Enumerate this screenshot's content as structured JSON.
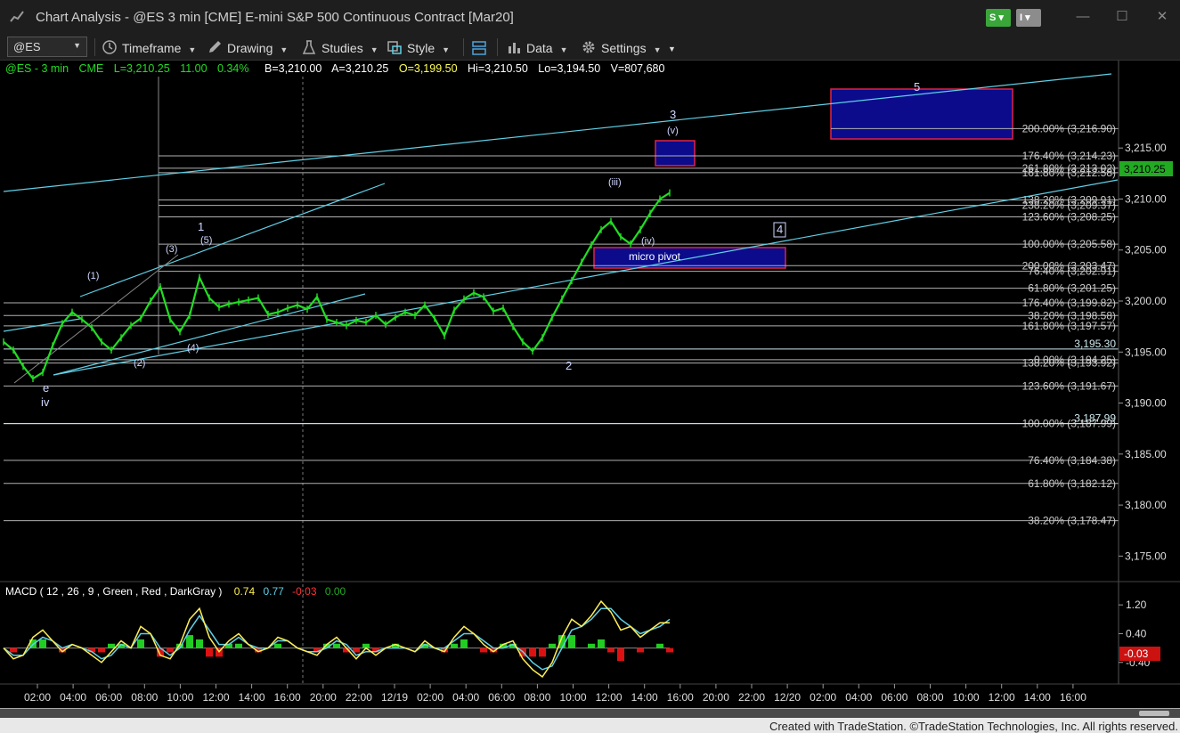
{
  "window": {
    "title": "Chart Analysis - @ES 3 min [CME] E-mini S&P 500 Continuous Contract [Mar20]",
    "badge_s": "S",
    "badge_i": "I",
    "minimize": "—",
    "maximize": "☐",
    "close": "✕"
  },
  "toolbar": {
    "symbol": "@ES",
    "timeframe": "Timeframe",
    "drawing": "Drawing",
    "studies": "Studies",
    "style": "Style",
    "data": "Data",
    "settings": "Settings"
  },
  "quote": {
    "symbol": "@ES - 3 min",
    "exchange": "CME",
    "last": "L=3,210.25",
    "change": "11.00",
    "pct": "0.34%",
    "bid": "B=3,210.00",
    "ask": "A=3,210.25",
    "open": "O=3,199.50",
    "high": "Hi=3,210.50",
    "low": "Lo=3,194.50",
    "volume": "V=807,680"
  },
  "colors": {
    "price": "#22dd22",
    "trendline": "#5fd0e6",
    "fib": "#b0b0b0",
    "zone_fill": "#0b0b8c",
    "zone_border": "#e0224a",
    "last_price_bg": "#22aa22",
    "macd_bg": "#cc1111"
  },
  "chart_data": [
    {
      "type": "line",
      "title": "@ES 3 min",
      "ylim": [
        3172.5,
        3222
      ],
      "y_ticks": [
        "3,215.00",
        "3,210.00",
        "3,205.00",
        "3,200.00",
        "3,195.00",
        "3,190.00",
        "3,185.00",
        "3,180.00",
        "3,175.00"
      ],
      "y_tick_values": [
        3215,
        3210,
        3205,
        3200,
        3195,
        3190,
        3185,
        3180,
        3175
      ],
      "x_ticks": [
        "02:00",
        "04:00",
        "06:00",
        "08:00",
        "10:00",
        "12:00",
        "14:00",
        "16:00",
        "20:00",
        "22:00",
        "12/19",
        "02:00",
        "04:00",
        "06:00",
        "08:00",
        "10:00",
        "12:00",
        "14:00",
        "16:00",
        "20:00",
        "22:00",
        "12/20",
        "02:00",
        "04:00",
        "06:00",
        "08:00",
        "10:00",
        "12:00",
        "14:00",
        "16:00"
      ],
      "last_price": "3,210.25",
      "series": [
        {
          "name": "@ES",
          "points": [
            [
              0,
              3196.0
            ],
            [
              1,
              3195.2
            ],
            [
              2,
              3193.6
            ],
            [
              3,
              3192.4
            ],
            [
              4,
              3193.0
            ],
            [
              5,
              3195.6
            ],
            [
              6,
              3197.8
            ],
            [
              7,
              3198.9
            ],
            [
              8,
              3198.2
            ],
            [
              9,
              3197.4
            ],
            [
              10,
              3196.0
            ],
            [
              11,
              3195.2
            ],
            [
              12,
              3196.4
            ],
            [
              13,
              3197.6
            ],
            [
              14,
              3198.3
            ],
            [
              15,
              3200.0
            ],
            [
              16,
              3201.4
            ],
            [
              17,
              3198.2
            ],
            [
              18,
              3197.0
            ],
            [
              19,
              3198.6
            ],
            [
              20,
              3202.3
            ],
            [
              21,
              3200.3
            ],
            [
              22,
              3199.4
            ],
            [
              23,
              3199.7
            ],
            [
              24,
              3199.9
            ],
            [
              25,
              3200.1
            ],
            [
              26,
              3200.3
            ],
            [
              27,
              3198.7
            ],
            [
              28,
              3198.9
            ],
            [
              29,
              3199.3
            ],
            [
              30,
              3199.6
            ],
            [
              31,
              3199.2
            ],
            [
              32,
              3200.4
            ],
            [
              33,
              3198.2
            ],
            [
              34,
              3197.9
            ],
            [
              35,
              3197.6
            ],
            [
              36,
              3198.1
            ],
            [
              37,
              3197.9
            ],
            [
              38,
              3198.6
            ],
            [
              39,
              3197.7
            ],
            [
              40,
              3198.4
            ],
            [
              41,
              3198.9
            ],
            [
              42,
              3198.6
            ],
            [
              43,
              3199.6
            ],
            [
              44,
              3198.3
            ],
            [
              45,
              3196.6
            ],
            [
              46,
              3199.1
            ],
            [
              47,
              3200.2
            ],
            [
              48,
              3200.8
            ],
            [
              49,
              3200.4
            ],
            [
              50,
              3199.0
            ],
            [
              51,
              3199.3
            ],
            [
              52,
              3197.5
            ],
            [
              53,
              3196.0
            ],
            [
              54,
              3195.1
            ],
            [
              55,
              3196.4
            ],
            [
              56,
              3198.4
            ],
            [
              57,
              3200.2
            ],
            [
              58,
              3202.0
            ],
            [
              59,
              3203.8
            ],
            [
              60,
              3205.5
            ],
            [
              61,
              3207.0
            ],
            [
              62,
              3207.8
            ],
            [
              63,
              3206.3
            ],
            [
              64,
              3205.6
            ],
            [
              65,
              3207.0
            ],
            [
              66,
              3208.6
            ],
            [
              67,
              3210.0
            ],
            [
              68,
              3210.6
            ]
          ]
        }
      ]
    },
    {
      "type": "line",
      "title": "MACD ( 12 , 26 , 9 , Green , Red , DarkGray )",
      "ylim": [
        -1.0,
        1.6
      ],
      "y_ticks": [
        "1.20",
        "0.40",
        "-0.40"
      ],
      "y_tick_values": [
        1.2,
        0.4,
        -0.4
      ],
      "current": "-0.03",
      "legend_values": [
        "0.74",
        "0.77",
        "-0.03",
        "0.00"
      ],
      "series": [
        {
          "name": "MACD",
          "values": [
            0.0,
            -0.3,
            -0.2,
            0.3,
            0.5,
            0.2,
            -0.1,
            0.1,
            0.0,
            -0.2,
            -0.4,
            -0.1,
            0.2,
            0.0,
            0.6,
            0.4,
            -0.2,
            -0.3,
            0.1,
            0.8,
            1.1,
            0.3,
            -0.1,
            0.2,
            0.4,
            0.1,
            -0.1,
            0.0,
            0.3,
            0.2,
            0.0,
            -0.1,
            -0.2,
            0.1,
            0.3,
            0.0,
            -0.3,
            0.0,
            -0.2,
            0.0,
            0.1,
            0.0,
            -0.1,
            0.2,
            0.0,
            -0.1,
            0.3,
            0.6,
            0.4,
            0.1,
            -0.1,
            0.1,
            0.2,
            -0.3,
            -0.6,
            -0.8,
            -0.4,
            0.3,
            0.8,
            0.6,
            0.9,
            1.3,
            1.0,
            0.5,
            0.6,
            0.3,
            0.5,
            0.7,
            0.7
          ]
        },
        {
          "name": "Signal",
          "values": [
            0.0,
            -0.2,
            -0.2,
            0.1,
            0.3,
            0.2,
            0.0,
            0.1,
            0.0,
            -0.1,
            -0.3,
            -0.2,
            0.1,
            0.0,
            0.4,
            0.4,
            0.0,
            -0.2,
            0.0,
            0.5,
            0.9,
            0.5,
            0.1,
            0.1,
            0.3,
            0.1,
            0.0,
            0.0,
            0.2,
            0.2,
            0.0,
            -0.1,
            -0.1,
            0.0,
            0.2,
            0.1,
            -0.2,
            -0.1,
            -0.1,
            0.0,
            0.0,
            0.0,
            -0.1,
            0.1,
            0.0,
            0.0,
            0.2,
            0.4,
            0.4,
            0.2,
            0.0,
            0.0,
            0.1,
            -0.1,
            -0.4,
            -0.6,
            -0.5,
            0.0,
            0.5,
            0.6,
            0.8,
            1.1,
            1.1,
            0.8,
            0.6,
            0.4,
            0.5,
            0.6,
            0.8
          ]
        }
      ]
    }
  ],
  "fib_levels": [
    {
      "label": "200.00% (3,216.90)",
      "price": 3216.9
    },
    {
      "label": "176.40% (3,214.23)",
      "price": 3214.23
    },
    {
      "label": "261.80% (3,213.02)",
      "price": 3213.02
    },
    {
      "label": "161.80% (3,212.58)",
      "price": 3212.58
    },
    {
      "label": "138.20% (3,209.91)",
      "price": 3209.91
    },
    {
      "label": "238.20% (3,209.37)",
      "price": 3209.37
    },
    {
      "label": "123.60% (3,208.25)",
      "price": 3208.25
    },
    {
      "label": "100.00% (3,205.58)",
      "price": 3205.58
    },
    {
      "label": "200.00% (3,203.47)",
      "price": 3203.47
    },
    {
      "label": "76.40% (3,202.91)",
      "price": 3202.91
    },
    {
      "label": "61.80% (3,201.25)",
      "price": 3201.25
    },
    {
      "label": "176.40% (3,199.82)",
      "price": 3199.82
    },
    {
      "label": "38.20% (3,198.58)",
      "price": 3198.58
    },
    {
      "label": "161.80% (3,197.57)",
      "price": 3197.57
    },
    {
      "label": "3,195.30",
      "price": 3195.3
    },
    {
      "label": "0.00% (3,194.25)",
      "price": 3194.25
    },
    {
      "label": "138.20% (3,193.92)",
      "price": 3193.92
    },
    {
      "label": "123.60% (3,191.67)",
      "price": 3191.67
    },
    {
      "label": "100.00% (3,187.99)",
      "price": 3187.99
    },
    {
      "label": "3,187.99",
      "price": 3187.99
    },
    {
      "label": "76.40% (3,184.38)",
      "price": 3184.38
    },
    {
      "label": "61.80% (3,182.12)",
      "price": 3182.12
    },
    {
      "label": "38.20% (3,178.47)",
      "price": 3178.47
    }
  ],
  "wave_labels": [
    "e",
    "iv",
    "(1)",
    "(2)",
    "(3)",
    "(4)",
    "(5)",
    "1",
    "2",
    "3",
    "4",
    "5",
    "(iii)",
    "(iv)",
    "(v)"
  ],
  "annotations": {
    "micro_pivot": "micro pivot"
  },
  "footer": {
    "credit": "Created with TradeStation. ©TradeStation Technologies, Inc. All rights reserved."
  }
}
